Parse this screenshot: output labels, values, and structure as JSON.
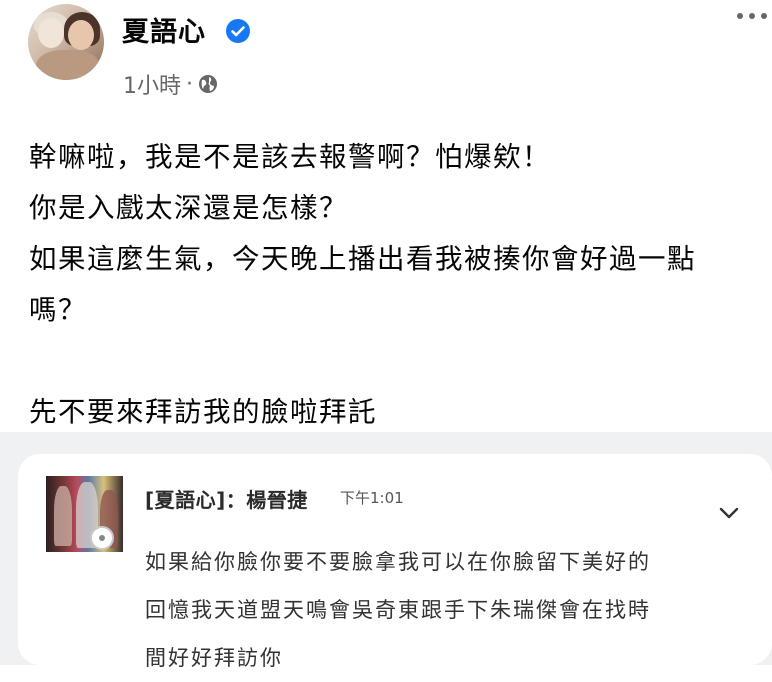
{
  "post": {
    "author": "夏語心",
    "author_verified": true,
    "time_label": "1小時",
    "separator": "·",
    "privacy_icon": "globe-icon",
    "lines": [
      "幹嘛啦，我是不是該去報警啊？怕爆欸！",
      "你是入戲太深還是怎樣？",
      "如果這麼生氣，今天晚上播出看我被揍你會好過一點",
      "嗎？",
      "",
      "先不要來拜訪我的臉啦拜託"
    ]
  },
  "embedded_message": {
    "sender": "[夏語心]：楊晉捷",
    "time": "下午1:01",
    "lines": [
      "如果給你臉你要不要臉拿我可以在你臉留下美好的",
      "回憶我天道盟天鳴會吳奇東跟手下朱瑞傑會在找時",
      "間好好拜訪你"
    ]
  },
  "colors": {
    "verified_blue": "#1877f2",
    "secondary_text": "#65676b",
    "screenshot_bg": "#f0f1f3"
  }
}
